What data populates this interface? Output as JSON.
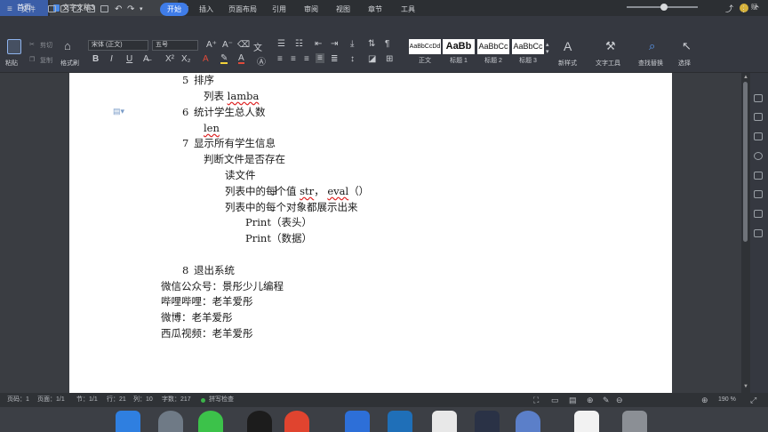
{
  "tabs": {
    "home": "首页",
    "document": "文字文稿3",
    "new_tab": "+"
  },
  "account": {
    "label": "赋"
  },
  "menu": {
    "file": "文件",
    "items": [
      "开始",
      "插入",
      "页面布局",
      "引用",
      "审阅",
      "视图",
      "章节",
      "工具"
    ],
    "active": "开始"
  },
  "ribbon": {
    "paste": "粘贴",
    "cut": "剪切",
    "copy": "复制",
    "format_painter": "格式刷",
    "font_name": "宋体 (正文)",
    "font_size": "五号",
    "bold": "B",
    "italic": "I",
    "underline": "U",
    "styles": [
      {
        "preview": "AaBbCcDd",
        "label": "正文"
      },
      {
        "preview": "AaBb",
        "label": "标题 1"
      },
      {
        "preview": "AaBbCc",
        "label": "标题 2"
      },
      {
        "preview": "AaBbCc",
        "label": "标题 3"
      }
    ],
    "new_style": "新样式",
    "text_tools": "文字工具",
    "find_replace": "查找替换",
    "select": "选择"
  },
  "document": {
    "lines": [
      {
        "num": "5",
        "text": "排序"
      },
      {
        "text": "列表  ",
        "wavy": "lamba"
      },
      {
        "num": "6",
        "text": "统计学生总人数"
      },
      {
        "wavy": "len"
      },
      {
        "num": "7",
        "text": "显示所有学生信息"
      },
      {
        "text": "判断文件是否存在"
      },
      {
        "text": "读文件"
      },
      {
        "text": "列表中的每个值 ",
        "wavy": "str",
        "mid": "， ",
        "wavy2": "eval",
        "tail": "（）"
      },
      {
        "text": "列表中的每个对象都展示出来"
      },
      {
        "text": "Print（表头）"
      },
      {
        "text": "Print（数据）"
      },
      {
        "num": "8",
        "text": "退出系统"
      },
      {
        "text": "微信公众号：景彤少儿编程"
      },
      {
        "text": "哔哩哔哩：老羊爱彤"
      },
      {
        "text": "微博：老羊爱彤"
      },
      {
        "text": "西瓜视频：老羊爱彤"
      }
    ]
  },
  "status": {
    "page_num": "页码：1",
    "pages": "页面：1/1",
    "section": "节：1/1",
    "row": "行：21",
    "col": "列：10",
    "words": "字数：217",
    "spellcheck": "拼写检查",
    "zoom": "190 %",
    "zoom_level": 0.52
  },
  "colors": {
    "accent": "#3f7ce8",
    "tab_home": "#3b5ea8",
    "wavy": "#d22222"
  }
}
